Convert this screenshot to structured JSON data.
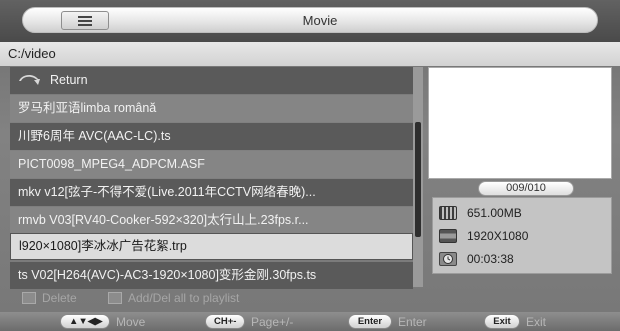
{
  "header": {
    "title": "Movie",
    "view_icon": "list-view-icon"
  },
  "path": "C:/video",
  "files": [
    {
      "label": "Return",
      "icon": "return-icon",
      "style": "dark"
    },
    {
      "label": "罗马利亚语limba română",
      "style": "light"
    },
    {
      "label": "川野6周年  AVC(AAC-LC).ts",
      "style": "dark"
    },
    {
      "label": "PICT0098_MPEG4_ADPCM.ASF",
      "style": "light"
    },
    {
      "label": "mkv  v12[弦子-不得不爱(Live.2011年CCTV网络春晚)...",
      "style": "dark"
    },
    {
      "label": "rmvb  V03[RV40-Cooker-592×320]太行山上.23fps.r...",
      "style": "light"
    },
    {
      "label": "l920×1080]李冰冰广告花絮.trp",
      "style": "selected"
    },
    {
      "label": "ts  V02[H264(AVC)-AC3-1920×1080]变形金刚.30fps.ts",
      "style": "dark"
    }
  ],
  "counter": "009/010",
  "info": {
    "size": "651.00MB",
    "resolution": "1920X1080",
    "duration": "00:03:38"
  },
  "options": {
    "delete_label": "Delete",
    "playlist_label": "Add/Del  all  to  playlist"
  },
  "help": {
    "move_key": "▲▼◀▶",
    "move_label": "Move",
    "page_key": "CH+-",
    "page_label": "Page+/-",
    "enter_key": "Enter",
    "enter_label": "Enter",
    "exit_key": "Exit",
    "exit_label": "Exit"
  }
}
